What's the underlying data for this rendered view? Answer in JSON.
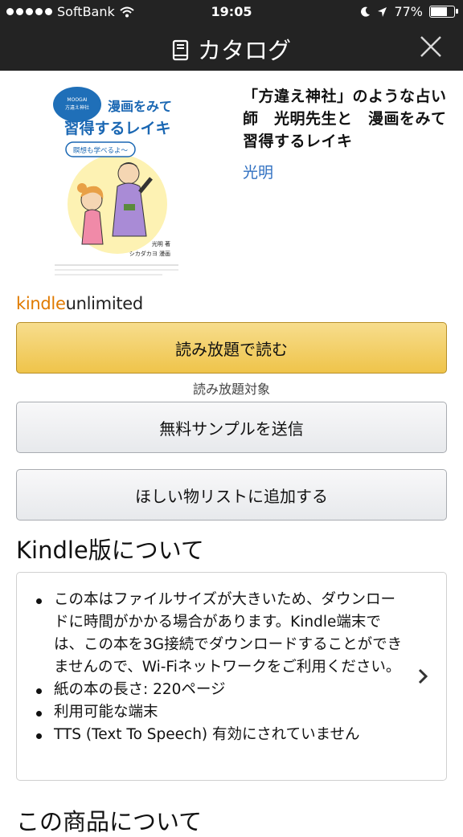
{
  "status_bar": {
    "carrier": "SoftBank",
    "time": "19:05",
    "battery": "77%",
    "battery_level": 0.77
  },
  "header": {
    "title": "カタログ",
    "icon": "catalog-icon",
    "close_icon": "close-icon"
  },
  "book": {
    "title": "「方違え神社」のような占い師　光明先生と　漫画をみて　習得するレイキ",
    "author": "光明",
    "cover": {
      "badge": "MOOGAI「方違え神社」のような占い師 光明先生と",
      "headline_1": "漫画をみて",
      "headline_2": "習得するレイキ",
      "tagline": "瞑想も学べるよ〜",
      "credit_author": "光明 著",
      "credit_artist": "シカダカヨ 漫画"
    }
  },
  "kindle_unlimited": {
    "logo_kindle": "kindle",
    "logo_unlimited": "unlimited",
    "read_button": "読み放題で読む",
    "note": "読み放題対象"
  },
  "actions": {
    "sample_button": "無料サンプルを送信",
    "wishlist_button": "ほしい物リストに追加する"
  },
  "kindle_section": {
    "title": "Kindle版について",
    "items": [
      "この本はファイルサイズが大きいため、ダウンロードに時間がかかる場合があります。Kindle端末では、この本を3G接続でダウンロードすることができませんので、Wi-Fiネットワークをご利用ください。",
      "紙の本の長さ: 220ページ",
      "利用可能な端末",
      "TTS (Text To Speech) 有効にされていません"
    ]
  },
  "product_section": {
    "title": "この商品について"
  },
  "colors": {
    "header_bg": "#232323",
    "primary_button": "#f0c14b",
    "link": "#2f6fc1",
    "kindle_orange": "#e07a00"
  }
}
